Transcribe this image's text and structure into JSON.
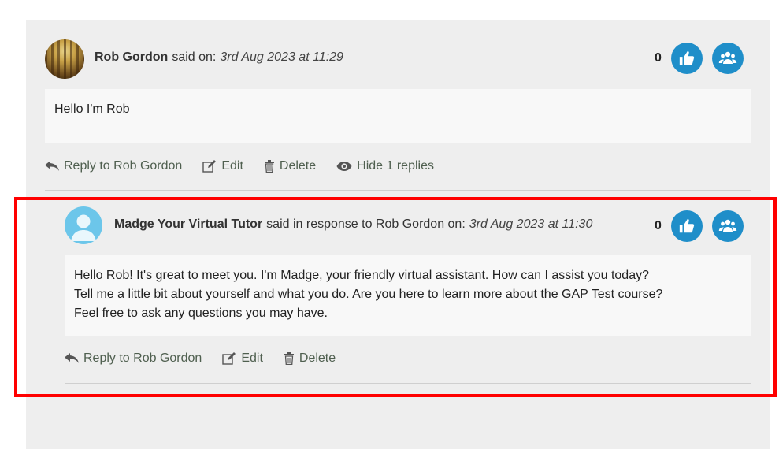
{
  "comment": {
    "author": "Rob Gordon",
    "said": "said on:",
    "date": "3rd Aug 2023 at 11:29",
    "votes": "0",
    "body": "Hello I'm Rob",
    "actions": {
      "reply": "Reply to Rob Gordon",
      "edit": "Edit",
      "delete": "Delete",
      "hide": "Hide 1 replies"
    }
  },
  "reply": {
    "author": "Madge Your Virtual Tutor",
    "said": "said in response to Rob Gordon on:",
    "date": "3rd Aug 2023 at 11:30",
    "votes": "0",
    "body_lines": [
      "Hello Rob! It's great to meet you. I'm Madge, your friendly virtual assistant. How can I assist you today?",
      "Tell me a little bit about yourself and what you do. Are you here to learn more about the GAP Test course?",
      "Feel free to ask any questions you may have."
    ],
    "actions": {
      "reply": "Reply to Rob Gordon",
      "edit": "Edit",
      "delete": "Delete"
    }
  },
  "colors": {
    "accent": "#1f8ec9",
    "highlight": "#ff0000",
    "panel": "#eeeeee"
  },
  "icons": [
    "thumbs-up-icon",
    "users-icon",
    "reply-arrow-icon",
    "edit-icon",
    "trash-icon",
    "eye-icon"
  ]
}
